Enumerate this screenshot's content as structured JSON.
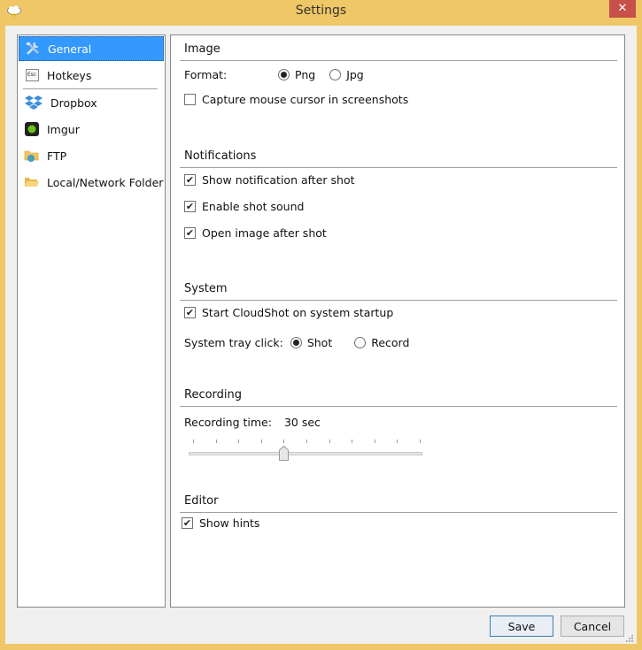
{
  "window": {
    "title": "Settings",
    "app_icon": "cloud-lightning-icon",
    "close_icon": "close-icon",
    "close_glyph": "✕"
  },
  "sidebar": {
    "items": [
      {
        "label": "General",
        "icon": "tools-icon",
        "selected": true
      },
      {
        "label": "Hotkeys",
        "icon": "esc-key-icon",
        "selected": false
      },
      {
        "label": "Dropbox",
        "icon": "dropbox-icon",
        "selected": false
      },
      {
        "label": "Imgur",
        "icon": "imgur-icon",
        "selected": false
      },
      {
        "label": "FTP",
        "icon": "ftp-folder-globe-icon",
        "selected": false
      },
      {
        "label": "Local/Network Folder",
        "icon": "folder-icon",
        "selected": false
      }
    ],
    "esc_text": "Esc"
  },
  "sections": {
    "image": {
      "title": "Image",
      "format_label": "Format:",
      "format_options": [
        {
          "label": "Png",
          "selected": true
        },
        {
          "label": "Jpg",
          "selected": false
        }
      ],
      "capture_cursor": {
        "label": "Capture mouse cursor in screenshots",
        "checked": false
      }
    },
    "notifications": {
      "title": "Notifications",
      "options": [
        {
          "label": "Show notification after shot",
          "checked": true
        },
        {
          "label": "Enable shot sound",
          "checked": true
        },
        {
          "label": "Open image after shot",
          "checked": true
        }
      ]
    },
    "system": {
      "title": "System",
      "startup": {
        "label": "Start CloudShot on system startup",
        "checked": true
      },
      "tray_label": "System tray click:",
      "tray_options": [
        {
          "label": "Shot",
          "selected": true
        },
        {
          "label": "Record",
          "selected": false
        }
      ]
    },
    "recording": {
      "title": "Recording",
      "time_label": "Recording time:",
      "time_value": "30 sec",
      "slider": {
        "ticks": 11,
        "position_index": 4,
        "fraction": 0.4
      }
    },
    "editor": {
      "title": "Editor",
      "show_hints": {
        "label": "Show hints",
        "checked": true
      }
    }
  },
  "footer": {
    "save_label": "Save",
    "cancel_label": "Cancel"
  },
  "check_glyph": "✔"
}
